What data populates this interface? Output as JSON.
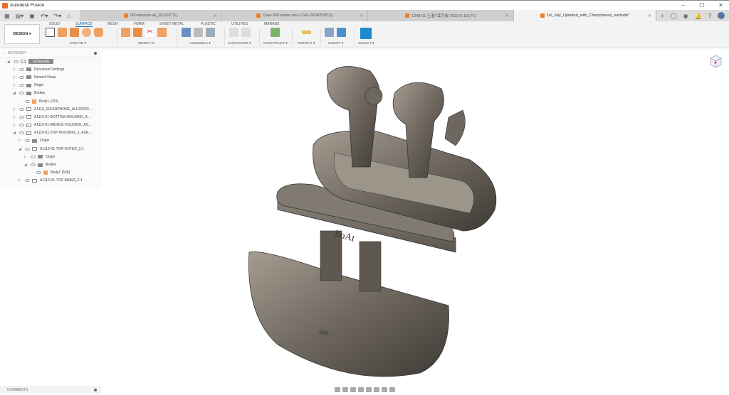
{
  "app": {
    "title": "Autodesk Fusion"
  },
  "tabs": [
    {
      "label": "000-nirvana-all_202212*(1)",
      "active": false
    },
    {
      "label": "Case 000-better-box-1249-20240528*(1)",
      "active": false
    },
    {
      "label": "1249-01  王者?耳手板  2023-6-19(1*1)",
      "active": false
    },
    {
      "label": "1st_July_Updated_with_Champhered_earbuds*",
      "active": true
    }
  ],
  "toolbar": {
    "workspace": "DESIGN ▾",
    "tabs": [
      "SOLID",
      "SURFACE",
      "MESH",
      "FORM",
      "SHEET METAL",
      "PLASTIC",
      "UTILITIES",
      "MANAGE"
    ],
    "active_tab": "SURFACE",
    "groups": [
      "CREATE ▾",
      "MODIFY ▾",
      "ASSEMBLE ▾",
      "CONFIGURE ▾",
      "CONSTRUCT ▾",
      "INSPECT ▾",
      "INSERT ▾",
      "SELECT ▾"
    ]
  },
  "browser": {
    "title": "BROWSER",
    "items": [
      {
        "label": "(Unsaved)",
        "level": 0,
        "type": "root"
      },
      {
        "label": "Document Settings",
        "level": 1,
        "type": "gear"
      },
      {
        "label": "Named Views",
        "level": 1,
        "type": "folder"
      },
      {
        "label": "Origin",
        "level": 1,
        "type": "folder"
      },
      {
        "label": "Bodies",
        "level": 1,
        "type": "folder"
      },
      {
        "label": "Body1 (331)",
        "level": 2,
        "type": "body"
      },
      {
        "label": "A1110_01EARPHONE_ALL2022O...",
        "level": 1,
        "type": "comp"
      },
      {
        "label": "A1110-01-BOTTOM-HOUSING_A...",
        "level": 1,
        "type": "comp"
      },
      {
        "label": "A1110-01-MIDDLE-HOUSING_AS...",
        "level": 1,
        "type": "comp"
      },
      {
        "label": "A1110-01-TOP-HOUSING_2_ASN...",
        "level": 1,
        "type": "comp"
      },
      {
        "label": "Origin",
        "level": 2,
        "type": "folder"
      },
      {
        "label": "A1110-01-TOP-OUTER_2:1",
        "level": 2,
        "type": "comp"
      },
      {
        "label": "Origin",
        "level": 3,
        "type": "folder"
      },
      {
        "label": "Bodies",
        "level": 3,
        "type": "folder"
      },
      {
        "label": "Body1 (509)",
        "level": 4,
        "type": "body"
      },
      {
        "label": "A1110-01-TOP-INNER_2:1",
        "level": 2,
        "type": "comp"
      }
    ]
  },
  "comments": {
    "label": "COMMENTS"
  },
  "model": {
    "logo": "boAt"
  }
}
